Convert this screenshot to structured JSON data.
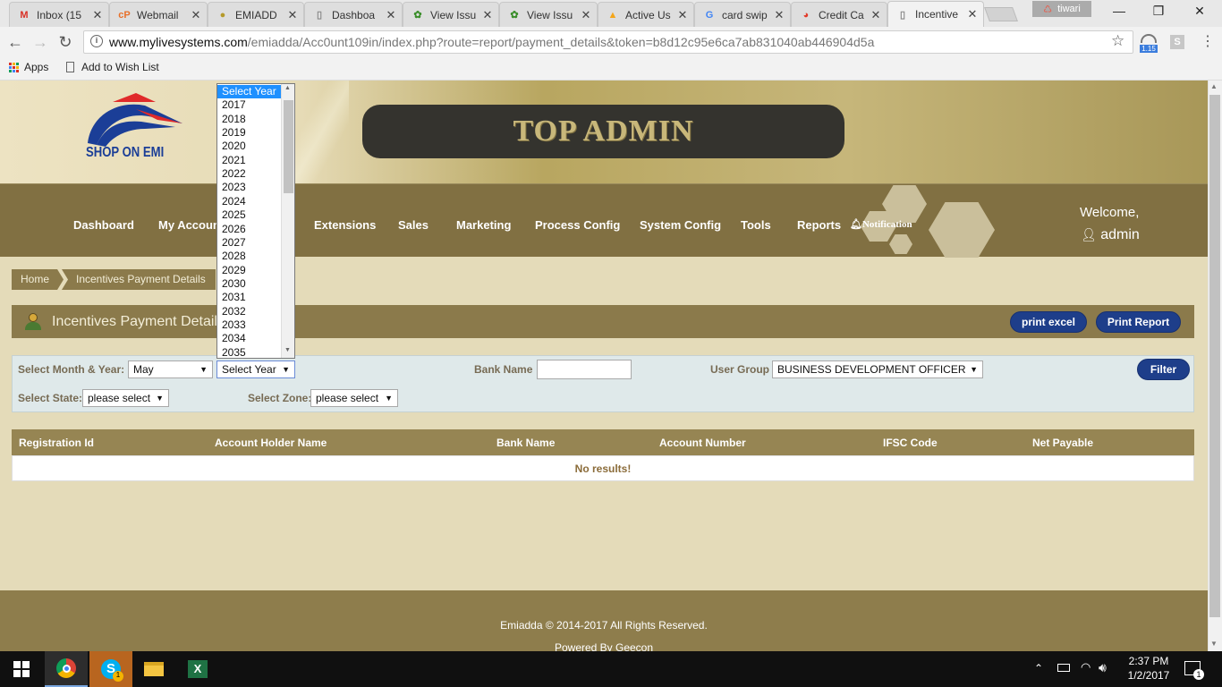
{
  "browser": {
    "tabs": [
      {
        "title": "Inbox (15",
        "icon": "gmail-icon"
      },
      {
        "title": "Webmail",
        "icon": "webmail-icon"
      },
      {
        "title": "EMIADD",
        "icon": "site-icon"
      },
      {
        "title": "Dashboa",
        "icon": "page-icon"
      },
      {
        "title": "View Issu",
        "icon": "bug-icon"
      },
      {
        "title": "View Issu",
        "icon": "bug-icon"
      },
      {
        "title": "Active Us",
        "icon": "analytics-icon"
      },
      {
        "title": "card swip",
        "icon": "google-icon"
      },
      {
        "title": "Credit Ca",
        "icon": "card-icon"
      },
      {
        "title": "Incentive",
        "icon": "page-icon"
      }
    ],
    "profile_name": "tiwari",
    "url_host": "www.mylivesystems.com",
    "url_path": "/emiadda/Acc0unt109in/index.php?route=report/payment_details&token=b8d12c95e6ca7ab831040ab446904d5a",
    "bookmarks": {
      "apps": "Apps",
      "wishlist": "Add to Wish List"
    },
    "ext_badge": "1.15",
    "ext_letter": "S"
  },
  "site": {
    "logo_text": "SHOP ON EMI",
    "banner": "TOP ADMIN",
    "nav": [
      "Dashboard",
      "My Account",
      "Extensions",
      "Sales",
      "Marketing",
      "Process Config",
      "System Config",
      "Tools",
      "Reports",
      "Notification"
    ],
    "welcome": "Welcome,",
    "user": "admin"
  },
  "breadcrumb": [
    "Home",
    "Incentives Payment Details"
  ],
  "panel": {
    "title": "Incentives Payment Details",
    "print_excel": "print excel",
    "print_report": "Print Report"
  },
  "filters": {
    "month_year_label": "Select Month & Year:",
    "month_value": "May",
    "year_value": "Select Year",
    "bank_label": "Bank Name",
    "bank_value": "",
    "user_group_label": "User Group",
    "user_group_value": "BUSINESS DEVELOPMENT OFFICER",
    "filter_button": "Filter",
    "state_label": "Select State:",
    "state_value": "please select",
    "zone_label": "Select Zone:",
    "zone_value": "please select"
  },
  "year_options": [
    "Select Year",
    "2017",
    "2018",
    "2019",
    "2020",
    "2021",
    "2022",
    "2023",
    "2024",
    "2025",
    "2026",
    "2027",
    "2028",
    "2029",
    "2030",
    "2031",
    "2032",
    "2033",
    "2034",
    "2035"
  ],
  "table": {
    "columns": [
      "Registration Id",
      "Account Holder Name",
      "Bank Name",
      "Account Number",
      "IFSC Code",
      "Net Payable"
    ],
    "empty_text": "No results!"
  },
  "footer": {
    "copyright": "Emiadda © 2014-2017 All Rights Reserved.",
    "powered": "Powered By Geecon"
  },
  "taskbar": {
    "time": "2:37 PM",
    "date": "1/2/2017",
    "notification_count": "1"
  }
}
